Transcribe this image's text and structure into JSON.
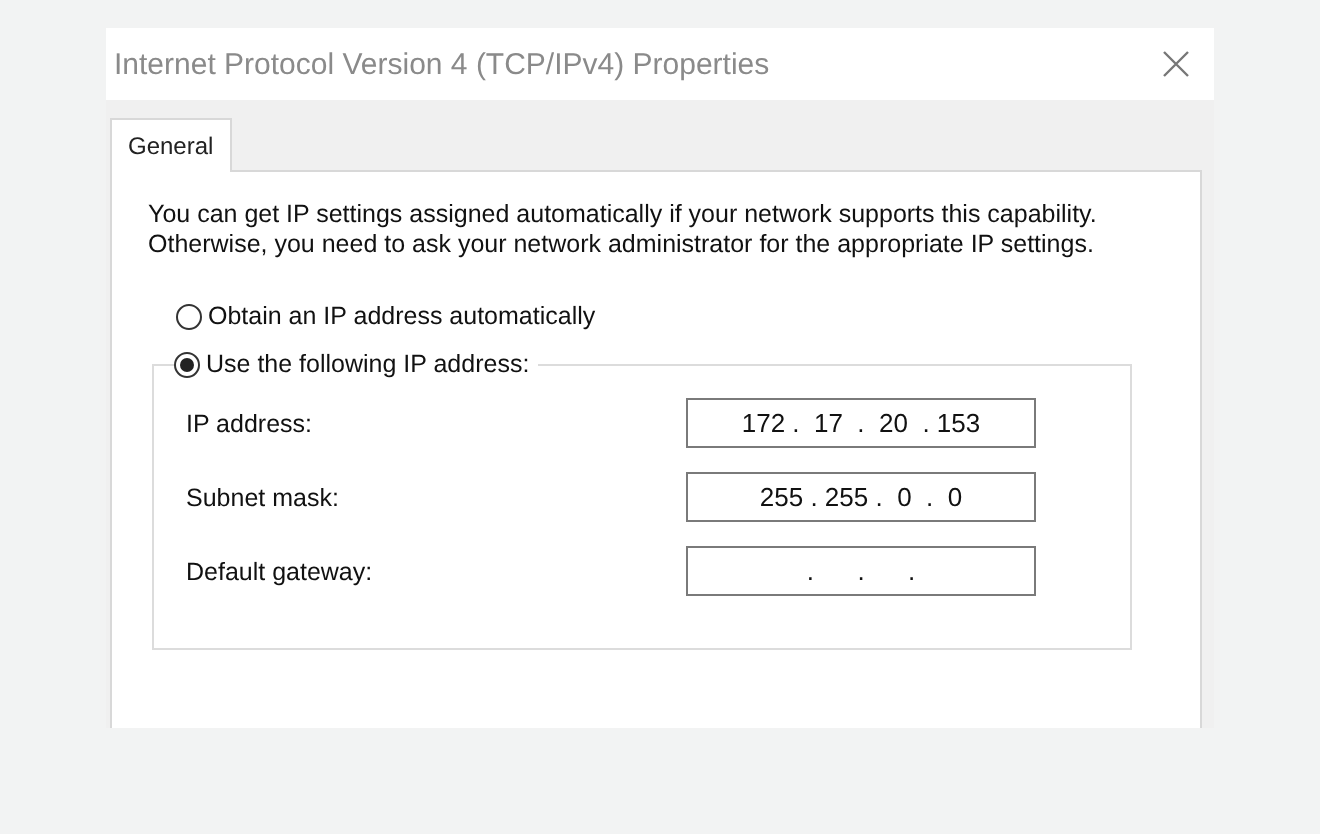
{
  "window": {
    "title": "Internet Protocol Version 4 (TCP/IPv4) Properties"
  },
  "tabs": [
    {
      "label": "General",
      "selected": true
    }
  ],
  "description": "You can get IP settings assigned automatically if your network supports this capability. Otherwise, you need to ask your network administrator for the appropriate IP settings.",
  "options": [
    {
      "label": "Obtain an IP address automatically",
      "selected": false
    },
    {
      "label": "Use the following IP address:",
      "selected": true
    }
  ],
  "fields": [
    {
      "label": "IP address:",
      "value": "172 .  17  .  20  . 153"
    },
    {
      "label": "Subnet mask:",
      "value": "255 . 255 .  0  .  0"
    },
    {
      "label": "Default gateway:",
      "value": ".      .      ."
    }
  ]
}
